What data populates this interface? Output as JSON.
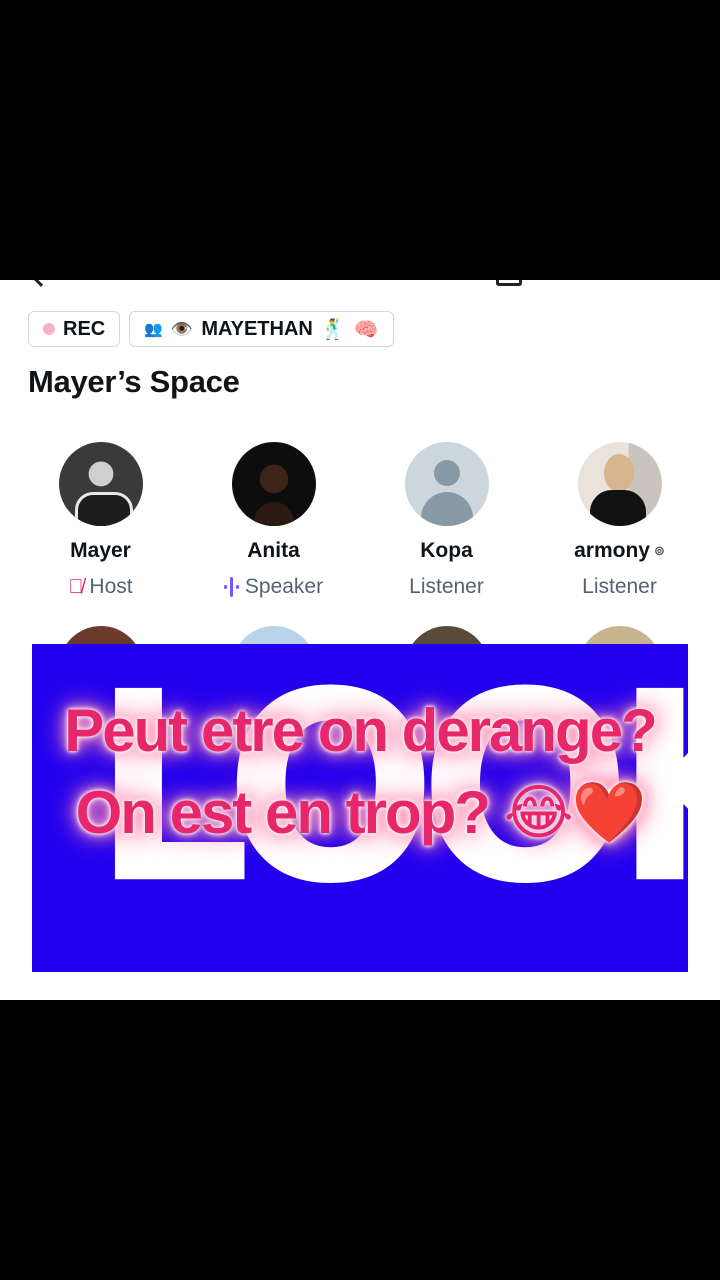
{
  "chips": {
    "rec": "REC",
    "host_tag": "MAYETHAN",
    "host_tag_emoji": "🕺",
    "host_tag_emoji2": "🧠",
    "eye_emoji": "👁️"
  },
  "space": {
    "title": "Mayer’s Space"
  },
  "participants": [
    {
      "name": "Mayer",
      "role": "Host"
    },
    {
      "name": "Anita",
      "role": "Speaker"
    },
    {
      "name": "Kopa",
      "role": "Listener"
    },
    {
      "name": "armony",
      "role": "Listener"
    }
  ],
  "overlay": {
    "word": "LOOK",
    "bg_color": "#2200ee"
  },
  "caption": {
    "line1": "Peut etre on derange?",
    "line2": "On est en trop? 😂❤️"
  },
  "colors": {
    "caption": "#e8266a",
    "accent": "#7856ff",
    "mute": "#e0245e"
  }
}
